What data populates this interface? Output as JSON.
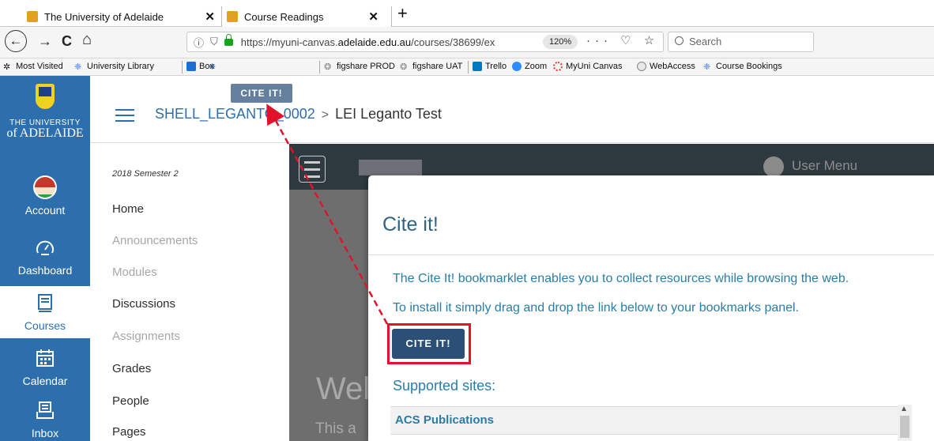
{
  "browser": {
    "tabs": [
      {
        "label": "The University of Adelaide",
        "close": "✕"
      },
      {
        "label": "Course Readings",
        "close": "✕"
      }
    ],
    "new_tab": "+",
    "nav": {
      "back": "←",
      "forward": "→",
      "reload": "C",
      "home": "⌂"
    },
    "url_prefix": "https://myuni-canvas.",
    "url_domain": "adelaide.edu.au",
    "url_suffix": "/courses/38699/ex",
    "zoom": "120%",
    "url_tools": "··· ♡ ☆",
    "search_placeholder": "Search",
    "bookmarks": [
      "Most Visited",
      "University Library",
      "Box",
      "figshare PROD",
      "figshare UAT",
      "Trello",
      "Zoom",
      "MyUni Canvas",
      "WebAccess",
      "Course Bookings"
    ]
  },
  "canvas": {
    "logo_line1": "THE UNIVERSITY",
    "logo_line2": "of ADELAIDE",
    "global_nav": [
      {
        "label": "Account"
      },
      {
        "label": "Dashboard"
      },
      {
        "label": "Courses"
      },
      {
        "label": "Calendar"
      },
      {
        "label": "Inbox"
      }
    ],
    "breadcrumb": {
      "course": "SHELL_LEGANTO_0002",
      "separator": ">",
      "current": "LEI Leganto Test"
    },
    "term": "2018 Semester 2",
    "course_nav": [
      {
        "label": "Home",
        "enabled": true
      },
      {
        "label": "Announcements",
        "enabled": false
      },
      {
        "label": "Modules",
        "enabled": false
      },
      {
        "label": "Discussions",
        "enabled": true
      },
      {
        "label": "Assignments",
        "enabled": false
      },
      {
        "label": "Grades",
        "enabled": true
      },
      {
        "label": "People",
        "enabled": true
      },
      {
        "label": "Pages",
        "enabled": true
      }
    ]
  },
  "leganto": {
    "user_menu": "User Menu",
    "welcome": "Wel",
    "sub": "This a"
  },
  "modal": {
    "title": "Cite it!",
    "p1": "The Cite It! bookmarklet enables you to collect resources while browsing the web.",
    "p2": "To install it simply drag and drop the link below to your bookmarks panel.",
    "button": "CITE IT!",
    "supported": "Supported sites:",
    "sites": [
      "ACS Publications"
    ]
  },
  "dragged_button": "CITE IT!",
  "colors": {
    "canvas_blue": "#2d6fac",
    "cite_button": "#2b4f75",
    "highlight": "#e0132a",
    "modal_text": "#2a7da6"
  }
}
